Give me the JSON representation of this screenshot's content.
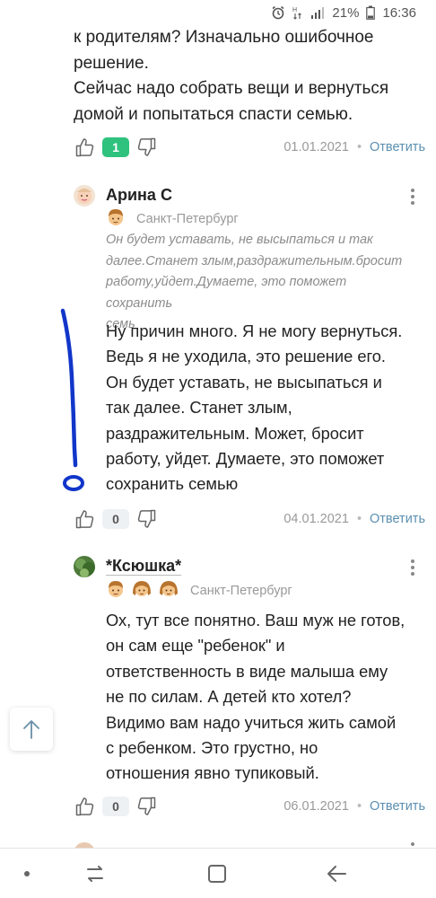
{
  "status_bar": {
    "battery": "21%",
    "time": "16:36",
    "icons": [
      "alarm-icon",
      "data-icon",
      "signal-icon",
      "battery-icon"
    ]
  },
  "prev_comment": {
    "text_lines": [
      "к родителям? Изначально ошибочное",
      "решение.",
      "Сейчас надо собрать вещи и вернуться",
      "домой и попытаться спасти семью."
    ],
    "likes": "1",
    "date": "01.01.2021",
    "reply_label": "Ответить"
  },
  "comment1": {
    "author": "Арина С",
    "city": "Санкт-Петербург",
    "quote_lines": [
      "Он будет уставать, не высыпаться и так",
      "далее.Станет злым,раздражительным.бросит",
      "работу,уйдет.Думаете, это поможет сохранить",
      "семь"
    ],
    "text_lines": [
      "Ну причин много. Я не могу вернуться.",
      "Ведь я не уходила, это решение его.",
      "Он будет уставать, не высыпаться и",
      "так далее. Станет злым,",
      "раздражительным. Может, бросит",
      "работу, уйдет. Думаете, это поможет",
      "сохранить семью"
    ],
    "likes": "0",
    "date": "04.01.2021",
    "reply_label": "Ответить"
  },
  "comment2": {
    "author": "*Ксюшка*",
    "city": "Санкт-Петербург",
    "text_lines": [
      "Ох, тут все понятно. Ваш муж не готов,",
      "он сам еще \"ребенок\" и",
      "ответственность в виде малыша ему",
      "не по силам. А детей кто хотел?",
      "Видимо вам надо учиться жить самой",
      "с ребенком. Это грустно, но",
      "отношения явно тупиковый."
    ],
    "likes": "0",
    "date": "06.01.2021",
    "reply_label": "Ответить"
  },
  "colors": {
    "like_badge": "#2ec27e",
    "reply_link": "#5a8fb0",
    "annotation_stroke": "#1136c9"
  }
}
